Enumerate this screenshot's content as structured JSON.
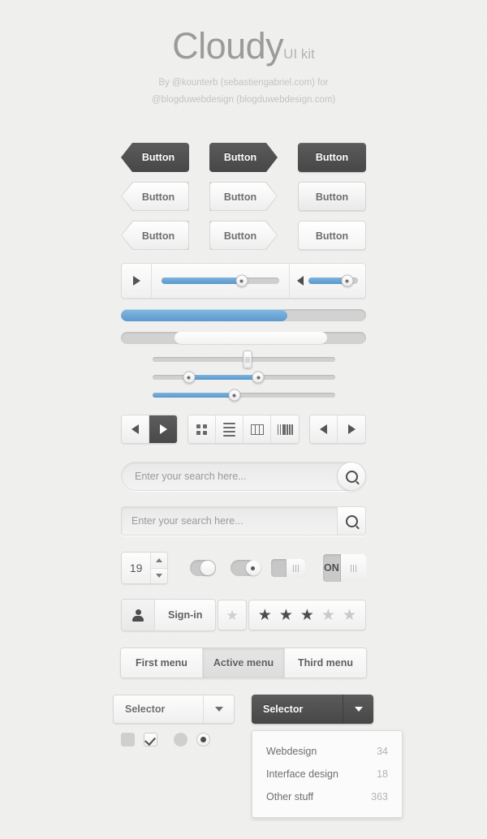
{
  "header": {
    "title": "Cloudy",
    "title_suffix": "UI kit",
    "credit_line1": "By @kounterb (sebastiengabriel.com) for",
    "credit_line2": "@blogduwebdesign (blogduwebdesign.com)"
  },
  "colors": {
    "accent_blue": "#5b99cd",
    "accent_blue_light": "#85b9e0",
    "dark_button": "#4f4f4f",
    "background": "#f2f2f1",
    "text_gray": "#6e6e6e",
    "muted_gray": "#b3b3b3"
  },
  "buttons": {
    "label": "Button",
    "rows": [
      {
        "style": "dark",
        "items": [
          "arrow-left",
          "arrow-right",
          "plain"
        ]
      },
      {
        "style": "light",
        "items": [
          "arrow-left",
          "arrow-right",
          "plain"
        ]
      },
      {
        "style": "lighter",
        "items": [
          "arrow-left",
          "arrow-right",
          "plain"
        ]
      }
    ]
  },
  "player": {
    "play_icon": "play-triangle-icon",
    "volume_icon": "speaker-icon",
    "track_percent": 68,
    "volume_percent": 78
  },
  "progress_bars": [
    {
      "name": "blue-progress",
      "percent": 68,
      "style": "blue"
    },
    {
      "name": "white-scroll",
      "percent": 68,
      "style": "white"
    }
  ],
  "sliders": [
    {
      "name": "vertical-handle-slider",
      "type": "single-vertical",
      "value": 52,
      "fill": false
    },
    {
      "name": "range-slider",
      "type": "range",
      "low": 20,
      "high": 58,
      "fill": true
    },
    {
      "name": "single-slider",
      "type": "single",
      "value": 45,
      "fill": true
    }
  ],
  "scrollbar": {
    "thumb_start": 22,
    "thumb_width": 62
  },
  "toolbar": {
    "nav_left": {
      "prev_icon": "triangle-left-icon",
      "next_icon": "triangle-right-icon",
      "active": "next"
    },
    "views": [
      {
        "name": "grid-view-icon"
      },
      {
        "name": "list-view-icon"
      },
      {
        "name": "column-view-icon"
      },
      {
        "name": "coverflow-view-icon"
      }
    ],
    "nav_right": {
      "prev_icon": "triangle-left-icon",
      "next_icon": "triangle-right-icon"
    }
  },
  "search": {
    "placeholder": "Enter your search here...",
    "value": "",
    "button_icon": "magnifier-icon"
  },
  "stepper": {
    "value": "19",
    "up_icon": "caret-up-icon",
    "down_icon": "caret-down-icon"
  },
  "toggles": [
    {
      "name": "pill-toggle-on",
      "state": "on",
      "knob": "plain"
    },
    {
      "name": "pill-toggle-dot",
      "state": "mid",
      "knob": "dot"
    },
    {
      "name": "rect-toggle",
      "state": "on",
      "knob": "grip"
    },
    {
      "name": "on-off-toggle",
      "state": "on",
      "label": "ON",
      "knob": "grip"
    }
  ],
  "signin": {
    "label": "Sign-in",
    "icon": "person-icon"
  },
  "rating": {
    "single_star": {
      "icon": "star-icon",
      "filled": false
    },
    "stars": [
      true,
      true,
      true,
      false,
      false
    ],
    "glyph": "★"
  },
  "menu_tabs": [
    {
      "label": "First menu",
      "active": false
    },
    {
      "label": "Active menu",
      "active": true
    },
    {
      "label": "Third menu",
      "active": false
    }
  ],
  "selectors": [
    {
      "label": "Selector",
      "style": "light",
      "caret": "caret-down-icon"
    },
    {
      "label": "Selector",
      "style": "dark",
      "caret": "caret-down-icon"
    }
  ],
  "dropdown": {
    "items": [
      {
        "label": "Webdesign",
        "count": "34"
      },
      {
        "label": "Interface design",
        "count": "18"
      },
      {
        "label": "Other stuff",
        "count": "363"
      }
    ]
  },
  "checkboxes": [
    {
      "name": "checkbox-unchecked",
      "checked": false
    },
    {
      "name": "checkbox-checked",
      "checked": true
    }
  ],
  "radios": [
    {
      "name": "radio-unselected",
      "selected": false
    },
    {
      "name": "radio-selected",
      "selected": true
    }
  ]
}
